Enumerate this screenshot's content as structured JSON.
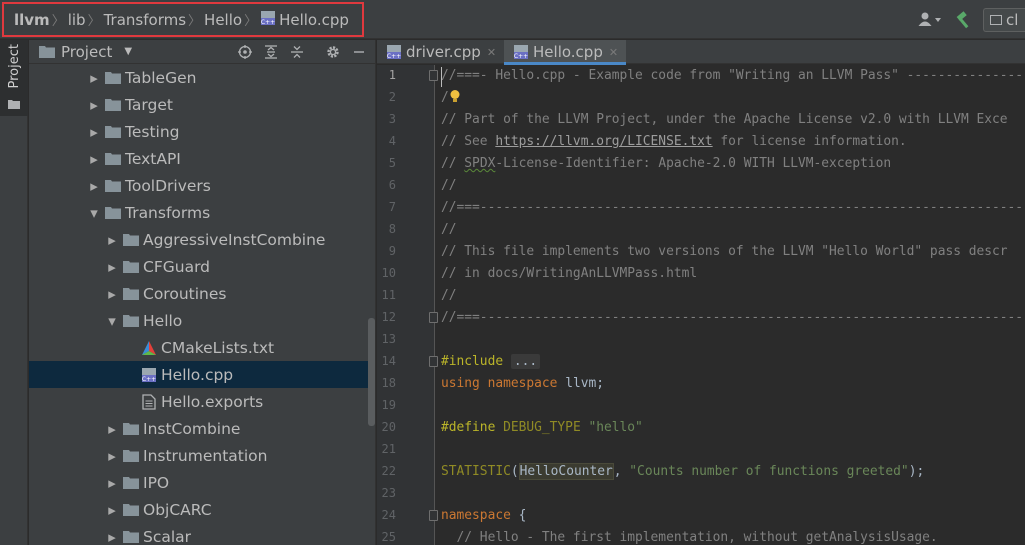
{
  "breadcrumb": {
    "items": [
      "llvm",
      "lib",
      "Transforms",
      "Hello",
      "Hello.cpp"
    ]
  },
  "toolbar": {
    "run_config": "cl"
  },
  "toolstrip": {
    "project_tab": "Project"
  },
  "project_panel": {
    "title": "Project",
    "tree": [
      {
        "label": "TableGen",
        "type": "folder",
        "depth": 0,
        "expanded": false
      },
      {
        "label": "Target",
        "type": "folder",
        "depth": 0,
        "expanded": false
      },
      {
        "label": "Testing",
        "type": "folder",
        "depth": 0,
        "expanded": false
      },
      {
        "label": "TextAPI",
        "type": "folder",
        "depth": 0,
        "expanded": false
      },
      {
        "label": "ToolDrivers",
        "type": "folder",
        "depth": 0,
        "expanded": false
      },
      {
        "label": "Transforms",
        "type": "folder",
        "depth": 0,
        "expanded": true
      },
      {
        "label": "AggressiveInstCombine",
        "type": "folder",
        "depth": 1,
        "expanded": false
      },
      {
        "label": "CFGuard",
        "type": "folder",
        "depth": 1,
        "expanded": false
      },
      {
        "label": "Coroutines",
        "type": "folder",
        "depth": 1,
        "expanded": false
      },
      {
        "label": "Hello",
        "type": "folder",
        "depth": 1,
        "expanded": true
      },
      {
        "label": "CMakeLists.txt",
        "type": "cmake",
        "depth": 2
      },
      {
        "label": "Hello.cpp",
        "type": "cpp",
        "depth": 2,
        "selected": true
      },
      {
        "label": "Hello.exports",
        "type": "text",
        "depth": 2
      },
      {
        "label": "InstCombine",
        "type": "folder",
        "depth": 1,
        "expanded": false
      },
      {
        "label": "Instrumentation",
        "type": "folder",
        "depth": 1,
        "expanded": false
      },
      {
        "label": "IPO",
        "type": "folder",
        "depth": 1,
        "expanded": false
      },
      {
        "label": "ObjCARC",
        "type": "folder",
        "depth": 1,
        "expanded": false
      },
      {
        "label": "Scalar",
        "type": "folder",
        "depth": 1,
        "expanded": false
      }
    ]
  },
  "editor": {
    "tabs": [
      {
        "label": "driver.cpp",
        "active": false
      },
      {
        "label": "Hello.cpp",
        "active": true
      }
    ],
    "line_numbers": [
      "1",
      "2",
      "3",
      "4",
      "5",
      "6",
      "7",
      "8",
      "9",
      "10",
      "11",
      "12",
      "13",
      "14",
      "18",
      "19",
      "20",
      "21",
      "22",
      "23",
      "24",
      "25"
    ],
    "lines": [
      [
        {
          "t": "//===- Hello.cpp - Example code from \"Writing an LLVM Pass\" ----------------",
          "c": "cmt"
        }
      ],
      [
        {
          "t": "/",
          "c": "cmt"
        },
        {
          "t": "💡",
          "c": "bulb"
        }
      ],
      [
        {
          "t": "// Part of the LLVM Project, under the Apache License v2.0 with LLVM Exce",
          "c": "cmt"
        }
      ],
      [
        {
          "t": "// See ",
          "c": "cmt"
        },
        {
          "t": "https://llvm.org/LICENSE.txt",
          "c": "link"
        },
        {
          "t": " for license information.",
          "c": "cmt"
        }
      ],
      [
        {
          "t": "// ",
          "c": "cmt"
        },
        {
          "t": "SPDX",
          "c": "cmt squig"
        },
        {
          "t": "-License-Identifier: Apache-2.0 WITH LLVM-exception",
          "c": "cmt"
        }
      ],
      [
        {
          "t": "//",
          "c": "cmt"
        }
      ],
      [
        {
          "t": "//===----------------------------------------------------------------------",
          "c": "cmt"
        }
      ],
      [
        {
          "t": "//",
          "c": "cmt"
        }
      ],
      [
        {
          "t": "// This file implements two versions of the LLVM \"Hello World\" pass descr",
          "c": "cmt"
        }
      ],
      [
        {
          "t": "// in docs/WritingAnLLVMPass.html",
          "c": "cmt"
        }
      ],
      [
        {
          "t": "//",
          "c": "cmt"
        }
      ],
      [
        {
          "t": "//===----------------------------------------------------------------------",
          "c": "cmt"
        }
      ],
      [
        {
          "t": "",
          "c": "ident"
        }
      ],
      [
        {
          "t": "#include",
          "c": "pp"
        },
        {
          "t": " ",
          "c": "ident"
        },
        {
          "t": "...",
          "c": "folded"
        }
      ],
      [
        {
          "t": "using",
          "c": "kw"
        },
        {
          "t": " ",
          "c": "ident"
        },
        {
          "t": "namespace",
          "c": "kw"
        },
        {
          "t": " llvm;",
          "c": "ident"
        }
      ],
      [
        {
          "t": "",
          "c": "ident"
        }
      ],
      [
        {
          "t": "#define",
          "c": "pp"
        },
        {
          "t": " ",
          "c": "ident"
        },
        {
          "t": "DEBUG_TYPE",
          "c": "macro"
        },
        {
          "t": " ",
          "c": "ident"
        },
        {
          "t": "\"hello\"",
          "c": "str"
        }
      ],
      [
        {
          "t": "",
          "c": "ident"
        }
      ],
      [
        {
          "t": "STATISTIC",
          "c": "macro"
        },
        {
          "t": "(",
          "c": "ident"
        },
        {
          "t": "HelloCounter",
          "c": "hl-var"
        },
        {
          "t": ", ",
          "c": "ident"
        },
        {
          "t": "\"Counts number of functions greeted\"",
          "c": "str"
        },
        {
          "t": ");",
          "c": "ident"
        }
      ],
      [
        {
          "t": "",
          "c": "ident"
        }
      ],
      [
        {
          "t": "namespace",
          "c": "kw"
        },
        {
          "t": " {",
          "c": "ident"
        }
      ],
      [
        {
          "t": "  // Hello - The first implementation, without getAnalysisUsage.",
          "c": "cmt"
        }
      ]
    ]
  }
}
